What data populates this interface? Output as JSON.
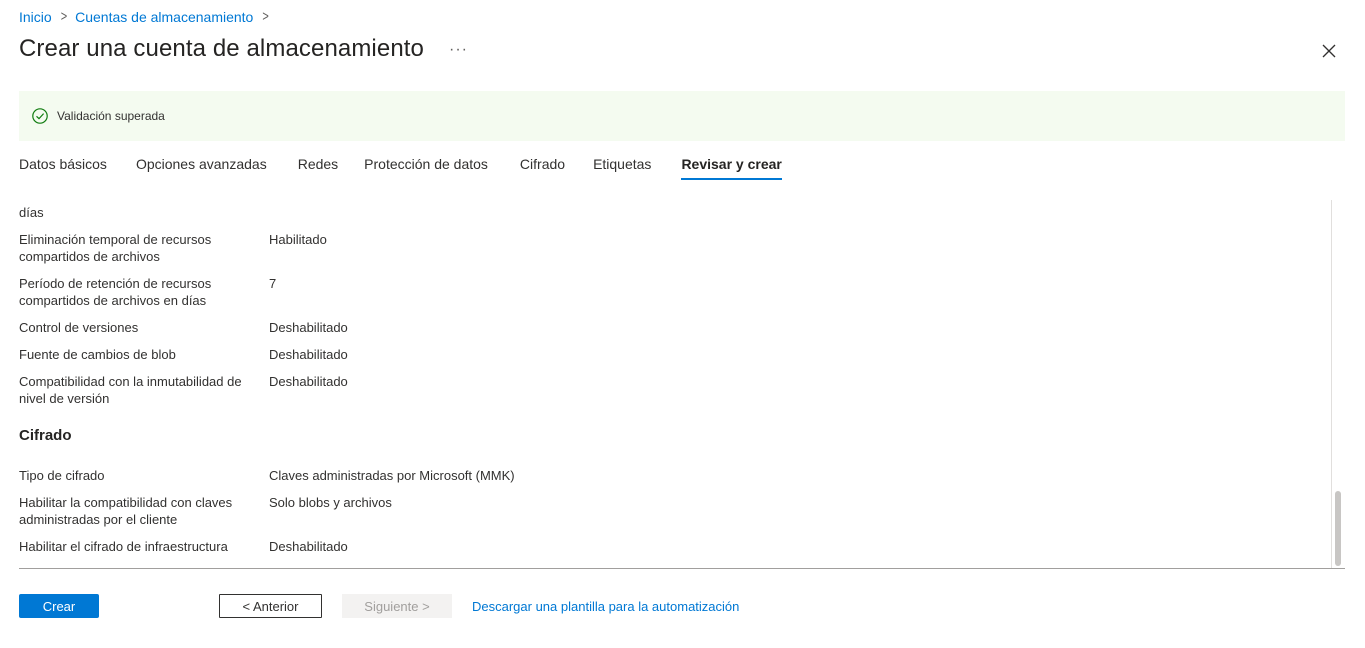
{
  "breadcrumb": {
    "items": [
      "Inicio",
      "Cuentas de almacenamiento"
    ]
  },
  "header": {
    "title": "Crear una cuenta de almacenamiento",
    "more": "···"
  },
  "banner": {
    "text": "Validación superada",
    "status_color": "#107c10",
    "background": "#f4fbf0"
  },
  "tabs": [
    {
      "label": "Datos básicos"
    },
    {
      "label": "Opciones avanzadas"
    },
    {
      "label": "Redes"
    },
    {
      "label": "Protección de datos"
    },
    {
      "label": "Cifrado"
    },
    {
      "label": "Etiquetas"
    },
    {
      "label": "Revisar y crear",
      "active": true
    }
  ],
  "review": {
    "fragment": "días",
    "data_protection_rows": [
      {
        "label": "Eliminación temporal de recursos compartidos de archivos",
        "value": "Habilitado"
      },
      {
        "label": "Período de retención de recursos compartidos de archivos en días",
        "value": "7"
      },
      {
        "label": "Control de versiones",
        "value": "Deshabilitado"
      },
      {
        "label": "Fuente de cambios de blob",
        "value": "Deshabilitado"
      },
      {
        "label": "Compatibilidad con la inmutabilidad de nivel de versión",
        "value": "Deshabilitado"
      }
    ],
    "encryption_title": "Cifrado",
    "encryption_rows": [
      {
        "label": "Tipo de cifrado",
        "value": "Claves administradas por Microsoft (MMK)"
      },
      {
        "label": "Habilitar la compatibilidad con claves administradas por el cliente",
        "value": "Solo blobs y archivos"
      },
      {
        "label": "Habilitar el cifrado de infraestructura",
        "value": "Deshabilitado"
      }
    ]
  },
  "footer": {
    "create": "Crear",
    "previous": "< Anterior",
    "next": "Siguiente >",
    "download_template": "Descargar una plantilla para la automatización"
  },
  "colors": {
    "accent": "#0078d4",
    "text": "#323130"
  }
}
